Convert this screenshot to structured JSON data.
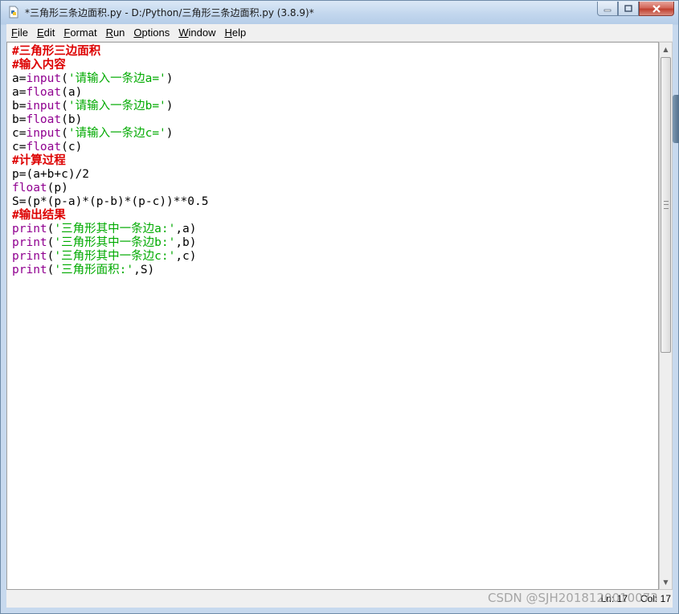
{
  "window": {
    "title": "*三角形三条边面积.py - D:/Python/三角形三条边面积.py (3.8.9)*"
  },
  "menu": [
    "File",
    "Edit",
    "Format",
    "Run",
    "Options",
    "Window",
    "Help"
  ],
  "menu_underline": [
    "F",
    "E",
    "F",
    "R",
    "O",
    "W",
    "H"
  ],
  "editor": {
    "lines": [
      [
        {
          "t": "#三角形三边面积",
          "c": "cm"
        }
      ],
      [
        {
          "t": "#输入内容",
          "c": "cm"
        }
      ],
      [
        {
          "t": "a="
        },
        {
          "t": "input",
          "c": "kw"
        },
        {
          "t": "("
        },
        {
          "t": "'请输入一条边a='",
          "c": "st"
        },
        {
          "t": ")"
        }
      ],
      [
        {
          "t": "a="
        },
        {
          "t": "float",
          "c": "kw"
        },
        {
          "t": "(a)"
        }
      ],
      [
        {
          "t": "b="
        },
        {
          "t": "input",
          "c": "kw"
        },
        {
          "t": "("
        },
        {
          "t": "'请输入一条边b='",
          "c": "st"
        },
        {
          "t": ")"
        }
      ],
      [
        {
          "t": "b="
        },
        {
          "t": "float",
          "c": "kw"
        },
        {
          "t": "(b)"
        }
      ],
      [
        {
          "t": "c="
        },
        {
          "t": "input",
          "c": "kw"
        },
        {
          "t": "("
        },
        {
          "t": "'请输入一条边c='",
          "c": "st"
        },
        {
          "t": ")"
        }
      ],
      [
        {
          "t": "c="
        },
        {
          "t": "float",
          "c": "kw"
        },
        {
          "t": "(c)"
        }
      ],
      [
        {
          "t": "#计算过程",
          "c": "cm"
        }
      ],
      [
        {
          "t": "p=(a+b+c)/2"
        }
      ],
      [
        {
          "t": "float",
          "c": "kw"
        },
        {
          "t": "(p)"
        }
      ],
      [
        {
          "t": "S=(p*(p-a)*(p-b)*(p-c))**0.5"
        }
      ],
      [
        {
          "t": "#输出结果",
          "c": "cm"
        }
      ],
      [
        {
          "t": "print",
          "c": "kw"
        },
        {
          "t": "("
        },
        {
          "t": "'三角形其中一条边a:'",
          "c": "st"
        },
        {
          "t": ",a)"
        }
      ],
      [
        {
          "t": "print",
          "c": "kw"
        },
        {
          "t": "("
        },
        {
          "t": "'三角形其中一条边b:'",
          "c": "st"
        },
        {
          "t": ",b)"
        }
      ],
      [
        {
          "t": "print",
          "c": "kw"
        },
        {
          "t": "("
        },
        {
          "t": "'三角形其中一条边c:'",
          "c": "st"
        },
        {
          "t": ",c)"
        }
      ],
      [
        {
          "t": "print",
          "c": "kw"
        },
        {
          "t": "("
        },
        {
          "t": "'三角形面积:'",
          "c": "st"
        },
        {
          "t": ",S)"
        }
      ]
    ]
  },
  "status": {
    "ln": "Ln: 17",
    "col": "Col: 17"
  },
  "watermark": "CSDN @SJH2018120010073",
  "colors": {
    "comment": "#dd0000",
    "keyword": "#900090",
    "string": "#00aa00"
  }
}
